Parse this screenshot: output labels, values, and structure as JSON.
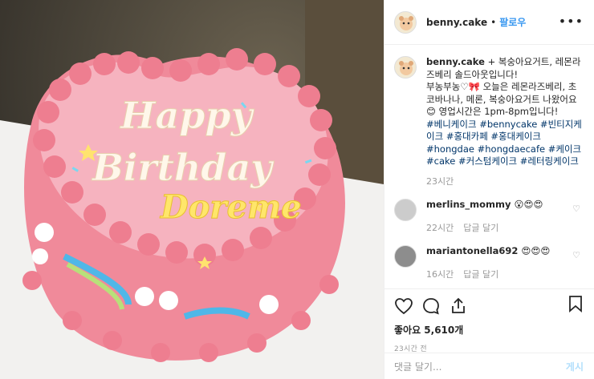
{
  "header": {
    "username": "benny.cake",
    "separator": "•",
    "follow_label": "팔로우",
    "more": "•••"
  },
  "caption": {
    "username": "benny.cake",
    "line1": " + 복숭아요거트, 레몬라즈베리 솔드아웃입니다!",
    "line2": "부농부농♡🎀 오늘은 레몬라즈베리, 초코바나나, 메론, 복숭아요거트 나왔어요😊 영업시간은 1pm-8pm입니다!",
    "hashtags": "#베니케이크 #bennycake #빈티지케이크 #홍대카페 #홍대케이크 #hongdae #hongdaecafe #케이크 #cake #커스텀케이크 #레터링케이크",
    "time": "23시간"
  },
  "comments": [
    {
      "username": "merlins_mommy",
      "text": "😮😍😍",
      "time": "22시간",
      "reply": "답글 달기"
    },
    {
      "username": "mariantonella692",
      "text": "😍😍😍",
      "time": "16시간",
      "reply": "답글 달기"
    }
  ],
  "actions": {
    "likes": "좋아요 5,610개",
    "post_time": "23시간 전"
  },
  "add_comment": {
    "placeholder": "댓글 달기...",
    "post_label": "게시"
  },
  "photo": {
    "cake_text_line1": "Happy",
    "cake_text_line2": "Birthday",
    "cake_text_line3": "Doreme"
  }
}
